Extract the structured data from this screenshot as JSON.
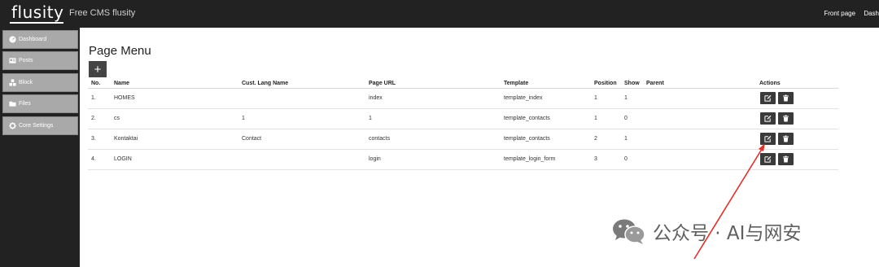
{
  "app": {
    "logo": "flusity",
    "tagline": "Free CMS flusity",
    "nav": [
      "Front page",
      "Dash"
    ]
  },
  "sidebar": {
    "items": [
      {
        "label": "Dashboard",
        "icon": "dashboard-icon"
      },
      {
        "label": "Posts",
        "icon": "posts-icon"
      },
      {
        "label": "Block",
        "icon": "blocks-icon"
      },
      {
        "label": "Files",
        "icon": "folder-icon"
      },
      {
        "label": "Core Settings",
        "icon": "gear-icon"
      }
    ]
  },
  "main": {
    "title": "Page Menu",
    "add_label": "+",
    "columns": [
      "No.",
      "Name",
      "Cust. Lang Name",
      "Page URL",
      "Template",
      "Position",
      "Show",
      "Parent",
      "Actions"
    ],
    "rows": [
      {
        "no": "1.",
        "name": "HOMES",
        "cust": "",
        "url": "index",
        "template": "template_index",
        "position": "1",
        "show": "1",
        "parent": ""
      },
      {
        "no": "2.",
        "name": "cs",
        "cust": "1",
        "url": "1",
        "template": "template_contacts",
        "position": "1",
        "show": "0",
        "parent": ""
      },
      {
        "no": "3.",
        "name": "Kontaktai",
        "cust": "Contact",
        "url": "contacts",
        "template": "template_contacts",
        "position": "2",
        "show": "1",
        "parent": ""
      },
      {
        "no": "4.",
        "name": "LOGIN",
        "cust": "",
        "url": "login",
        "template": "template_login_form",
        "position": "3",
        "show": "0",
        "parent": ""
      }
    ]
  },
  "watermark": {
    "text": "公众号 · AI与网安"
  },
  "colors": {
    "topbar": "#222222",
    "sidebar_item": "#a9a9a9",
    "action_button": "#3a3a3a",
    "annotation_arrow": "#e0302a"
  }
}
